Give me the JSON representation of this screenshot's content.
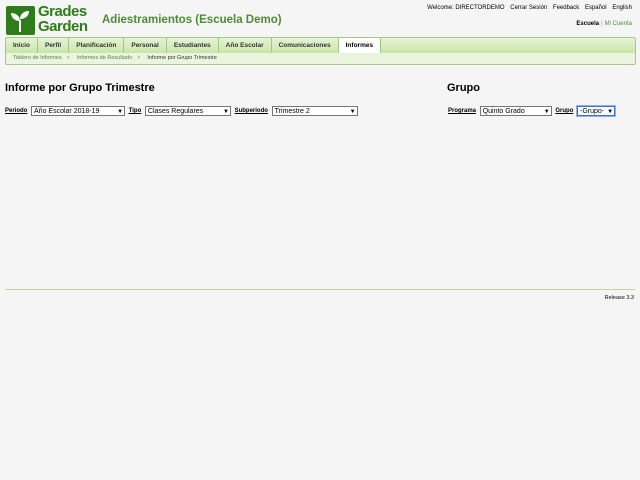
{
  "app": {
    "logo_line1": "Grades",
    "logo_line2": "Garden",
    "school_title": "Adiestramientos (Escuela Demo)"
  },
  "topbar": {
    "welcome": "Welcome: DIRECTORDEMO",
    "logout": "Cerrar Sesión",
    "feedback": "Feedback",
    "lang_es": "Español",
    "lang_en": "English",
    "escuela": "Escuela",
    "separator": "|",
    "mi_cuenta": "Mi Cuenta"
  },
  "nav": {
    "tabs": [
      "Inicio",
      "Perfil",
      "Planificación",
      "Personal",
      "Estudiantes",
      "Año Escolar",
      "Comunicaciones",
      "Informes"
    ],
    "active": "Informes"
  },
  "breadcrumbs": [
    "Tablero de Informes",
    "Informes de Resultado",
    "Informe por Grupo Trimestre"
  ],
  "breadcrumb_arrow": ">",
  "main": {
    "title": "Informe por Grupo Trimestre",
    "periodo_label": "Periodo",
    "periodo_value": "Año Escolar 2018-19",
    "tipo_label": "Tipo",
    "tipo_value": "Clases Regulares",
    "subperiodo_label": "Subperiodo",
    "subperiodo_value": "Trimestre 2"
  },
  "grupo_panel": {
    "title": "Grupo",
    "programa_label": "Programa",
    "programa_value": "Quinto Grado",
    "grupo_label": "Grupo",
    "grupo_value": "-Grupo-"
  },
  "footer": {
    "release": "Release 3.3"
  },
  "colors": {
    "brand_green": "#2e7d1a",
    "accent_green": "#4e8c33",
    "nav_border": "#a3c98a"
  }
}
